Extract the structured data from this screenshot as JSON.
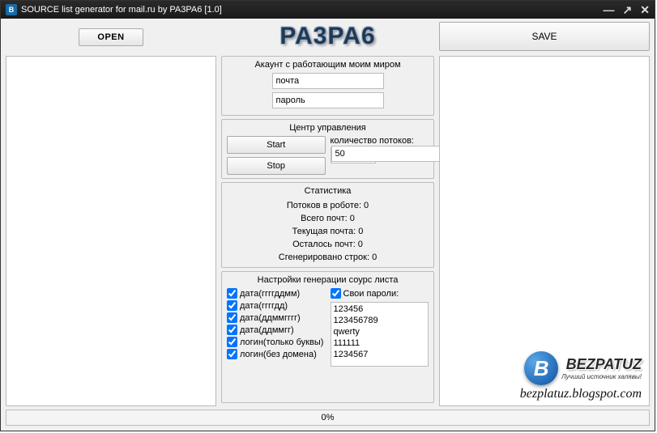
{
  "window": {
    "icon_letter": "B",
    "title": "SOURCE list generator for mail.ru by PA3PA6 [1.0]"
  },
  "buttons": {
    "open": "OPEN",
    "save": "SAVE",
    "start": "Start",
    "stop": "Stop"
  },
  "logo_text": "PA3PA6",
  "account": {
    "title": "Акаунт с работающим моим миром",
    "mail_value": "почта",
    "pass_value": "пароль"
  },
  "control": {
    "title": "Центр управления",
    "threads_label": "количество потоков:",
    "threads_value": "50"
  },
  "stats": {
    "title": "Статистика",
    "rows": [
      "Потоков в роботе: 0",
      "Всего почт: 0",
      "Текущая почта: 0",
      "Осталось почт: 0",
      "Сгенерировано строк: 0"
    ]
  },
  "gen": {
    "title": "Настройки генерации соурс листа",
    "date1": "дата(ггггддмм)",
    "date2": "дата(ггггдд)",
    "date3": "дата(ддммгггг)",
    "date4": "дата(ддммгг)",
    "login1": "логин(только буквы)",
    "login2": "логин(без домена)",
    "ownpw_label": "Свои пароли:",
    "pw_list": [
      "123456",
      "123456789",
      "qwerty",
      "111111",
      "1234567"
    ]
  },
  "progress": "0%",
  "watermark": {
    "badge_letter": "B",
    "name": "BEZPATUZ",
    "sub": "Лучший источник халявы!",
    "url": "bezplatuz.blogspot.com"
  }
}
